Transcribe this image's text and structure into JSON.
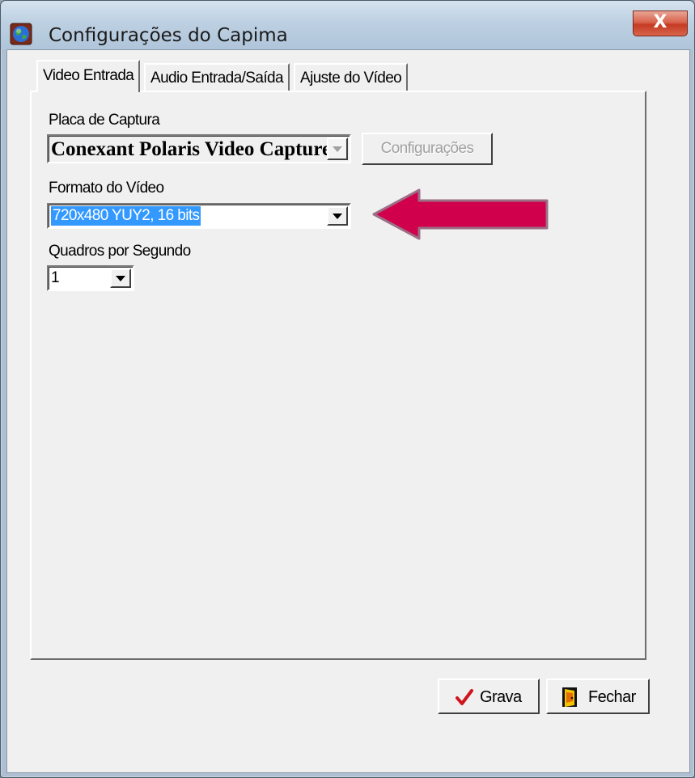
{
  "window": {
    "title": "Configurações do Capima",
    "close_label": "X"
  },
  "tabs": [
    {
      "label": "Video Entrada",
      "active": true
    },
    {
      "label": "Audio Entrada/Saída",
      "active": false
    },
    {
      "label": "Ajuste do Vídeo",
      "active": false
    }
  ],
  "video_entrada": {
    "placa_label": "Placa de Captura",
    "placa_value": "Conexant Polaris Video Capture",
    "config_button": "Configurações",
    "formato_label": "Formato do Vídeo",
    "formato_value": "720x480 YUY2, 16 bits",
    "quadros_label": "Quadros por Segundo",
    "quadros_value": "1"
  },
  "footer": {
    "grava_label": "Grava",
    "fechar_label": "Fechar"
  },
  "icons": {
    "title": "app-globe-icon",
    "grava": "checkmark-icon",
    "fechar": "exit-door-icon"
  },
  "colors": {
    "annotation_arrow": "#d1004d",
    "selection": "#3399ff",
    "close_button": "#c43b22"
  }
}
